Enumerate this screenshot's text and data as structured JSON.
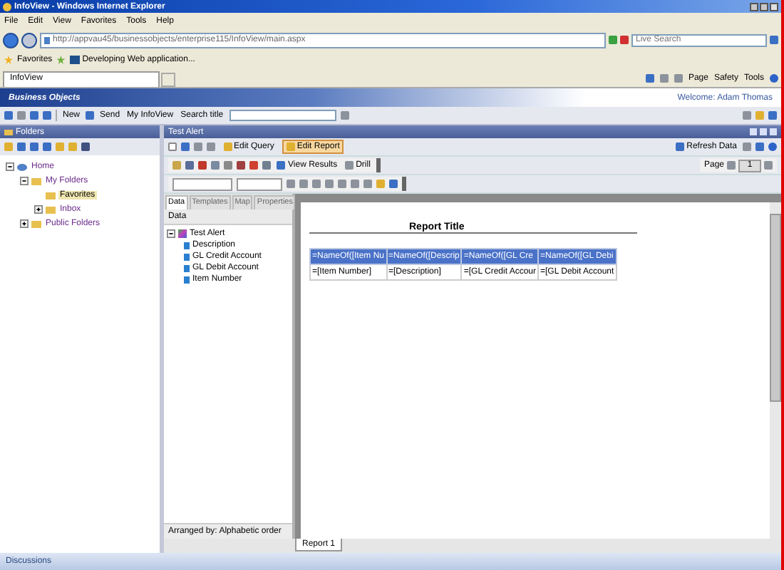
{
  "window": {
    "title": "InfoView - Windows Internet Explorer"
  },
  "menu": [
    "File",
    "Edit",
    "View",
    "Favorites",
    "Tools",
    "Help"
  ],
  "address": {
    "url": "http://appvau45/businessobjects/enterprise115/InfoView/main.aspx",
    "search_placeholder": "Live Search"
  },
  "favorites_bar": {
    "label": "Favorites",
    "link": "Developing Web application..."
  },
  "tabs": [
    {
      "label": "InfoView",
      "selected": true
    }
  ],
  "command_bar": [
    "Page",
    "Safety",
    "Tools"
  ],
  "app_header": {
    "logo": "Business Objects",
    "welcome": "Welcome: Adam Thomas"
  },
  "app_toolbar": {
    "new": "New",
    "send": "Send",
    "my_infoview": "My InfoView",
    "search_label": "Search title"
  },
  "folders": {
    "title": "Folders",
    "tree": [
      {
        "label": "Home",
        "expanded": true,
        "selected": false,
        "children": [
          {
            "label": "My Folders",
            "expanded": true,
            "selected": false,
            "children": [
              {
                "label": "Favorites",
                "selected": true
              },
              {
                "label": "Inbox",
                "expanded": false,
                "selected": false
              }
            ]
          },
          {
            "label": "Public Folders",
            "expanded": false,
            "selected": false
          }
        ]
      }
    ]
  },
  "document": {
    "title": "Test Alert",
    "modes": [
      {
        "label": "Edit Query",
        "selected": false
      },
      {
        "label": "Edit Report",
        "selected": true
      }
    ],
    "refresh": "Refresh Data",
    "view_results": "View Results",
    "drill": "Drill",
    "page_label": "Page",
    "page_value": "1",
    "side_tabs": [
      {
        "label": "Data",
        "selected": true
      },
      {
        "label": "Templates",
        "selected": false
      },
      {
        "label": "Map",
        "selected": false
      },
      {
        "label": "Properties",
        "selected": false
      }
    ],
    "data_header": "Data",
    "data_tree": {
      "label": "Test Alert",
      "expanded": true,
      "children": [
        "Description",
        "GL Credit Account",
        "GL Debit Account",
        "Item Number"
      ]
    },
    "arranged_by": "Arranged by: Alphabetic order",
    "report": {
      "title": "Report Title",
      "columns": [
        "=NameOf([Item Nu",
        "=NameOf([Descrip",
        "=NameOf([GL Cre",
        "=NameOf([GL Debi"
      ],
      "row": [
        "=[Item Number]",
        "=[Description]",
        "=[GL Credit Accour",
        "=[GL Debit Account"
      ]
    },
    "report_tabs": [
      {
        "label": "Report 1",
        "selected": true
      }
    ]
  },
  "status_bar": {
    "discussions": "Discussions"
  }
}
